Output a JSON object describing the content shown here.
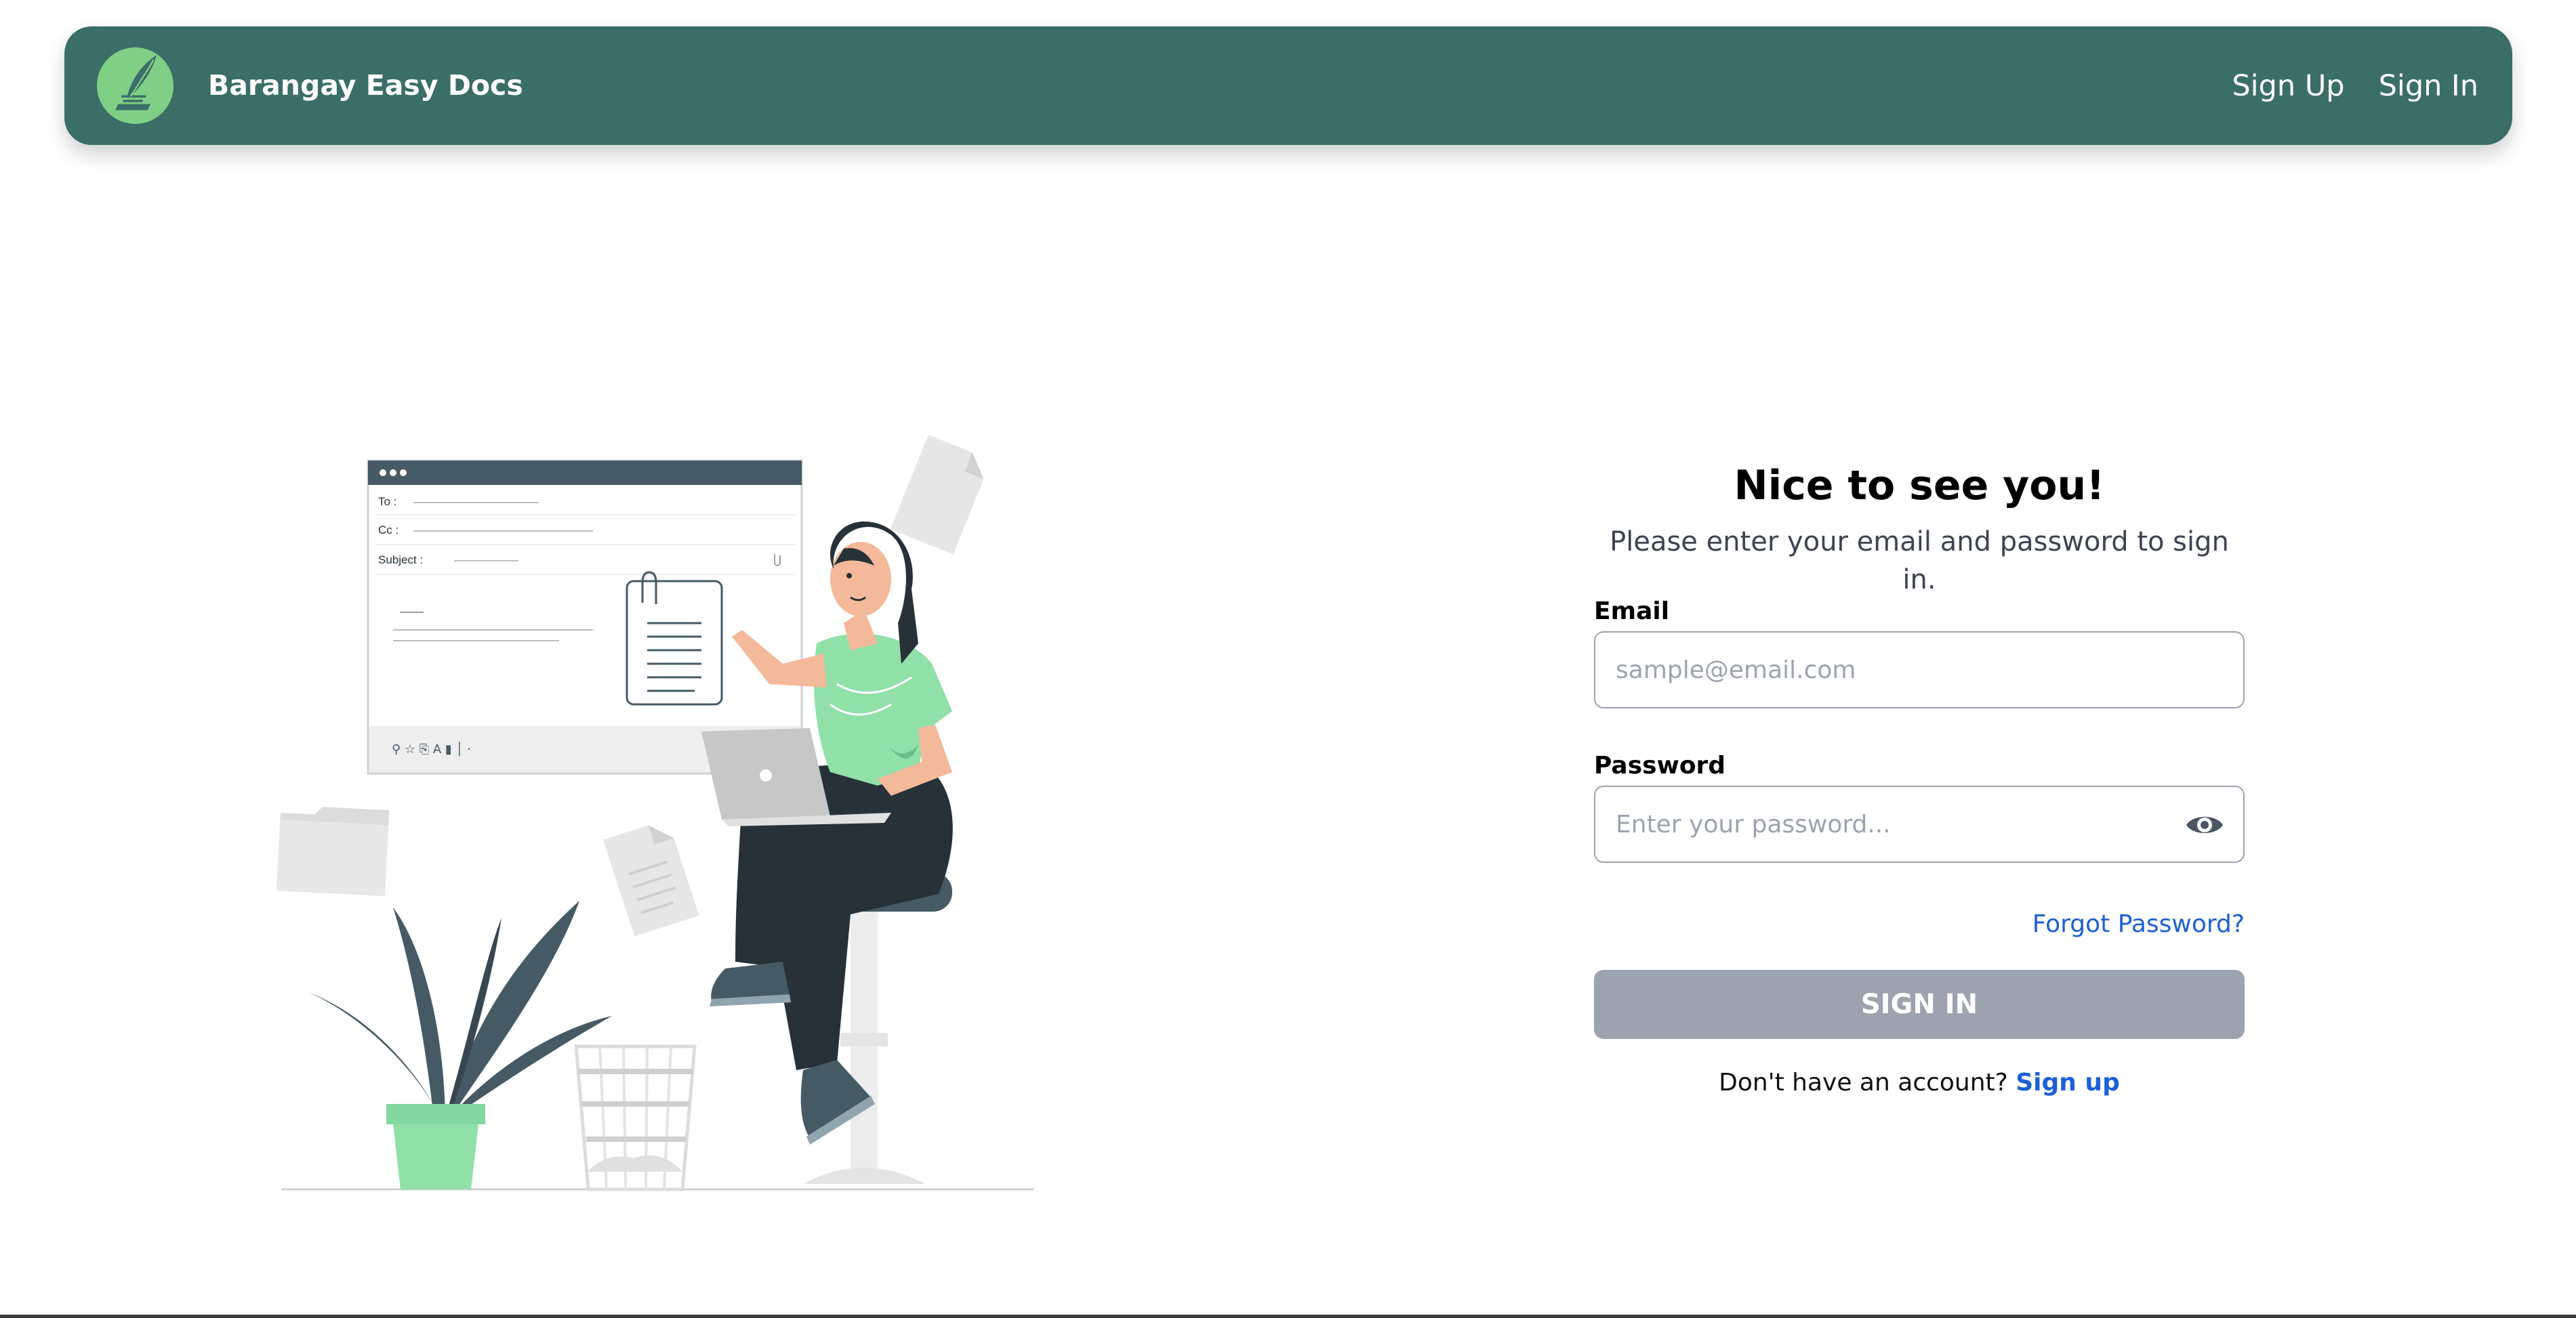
{
  "navbar": {
    "brand": "Barangay Easy Docs",
    "links": [
      "Sign Up",
      "Sign In"
    ],
    "bg_color": "#3a6e66"
  },
  "illustration": {
    "email_window": {
      "to_label": "To :",
      "cc_label": "Cc :",
      "subject_label": "Subject :"
    }
  },
  "form": {
    "title": "Nice to see you!",
    "subtitle": "Please enter your email and password to sign in.",
    "email_label": "Email",
    "email_placeholder": "sample@email.com",
    "password_label": "Password",
    "password_placeholder": "Enter your password...",
    "forgot_password": "Forgot Password?",
    "signin_button": "SIGN IN",
    "no_account_text": "Don't have an account?",
    "signup_link": "Sign up",
    "accent_color": "#1d5fd6",
    "button_color": "#9ca3af"
  }
}
